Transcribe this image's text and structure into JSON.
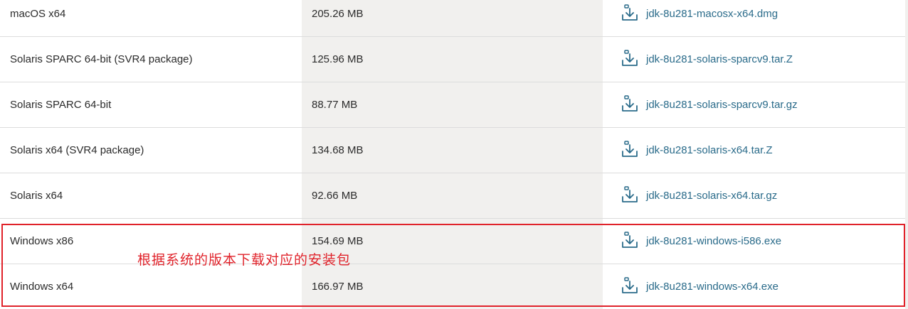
{
  "downloads": {
    "rows": [
      {
        "product": "macOS x64",
        "size": "205.26 MB",
        "file": "jdk-8u281-macosx-x64.dmg"
      },
      {
        "product": "Solaris SPARC 64-bit (SVR4 package)",
        "size": "125.96 MB",
        "file": "jdk-8u281-solaris-sparcv9.tar.Z"
      },
      {
        "product": "Solaris SPARC 64-bit",
        "size": "88.77 MB",
        "file": "jdk-8u281-solaris-sparcv9.tar.gz"
      },
      {
        "product": "Solaris x64 (SVR4 package)",
        "size": "134.68 MB",
        "file": "jdk-8u281-solaris-x64.tar.Z"
      },
      {
        "product": "Solaris x64",
        "size": "92.66 MB",
        "file": "jdk-8u281-solaris-x64.tar.gz"
      },
      {
        "product": "Windows x86",
        "size": "154.69 MB",
        "file": "jdk-8u281-windows-i586.exe"
      },
      {
        "product": "Windows x64",
        "size": "166.97 MB",
        "file": "jdk-8u281-windows-x64.exe"
      }
    ]
  },
  "annotation": {
    "text": "根据系统的版本下载对应的安装包",
    "color": "#e0222a"
  },
  "colors": {
    "link": "#2a6b8a",
    "size_column_bg": "#f1f0ee",
    "highlight": "#e0222a"
  },
  "icons": {
    "download": "download-icon"
  }
}
